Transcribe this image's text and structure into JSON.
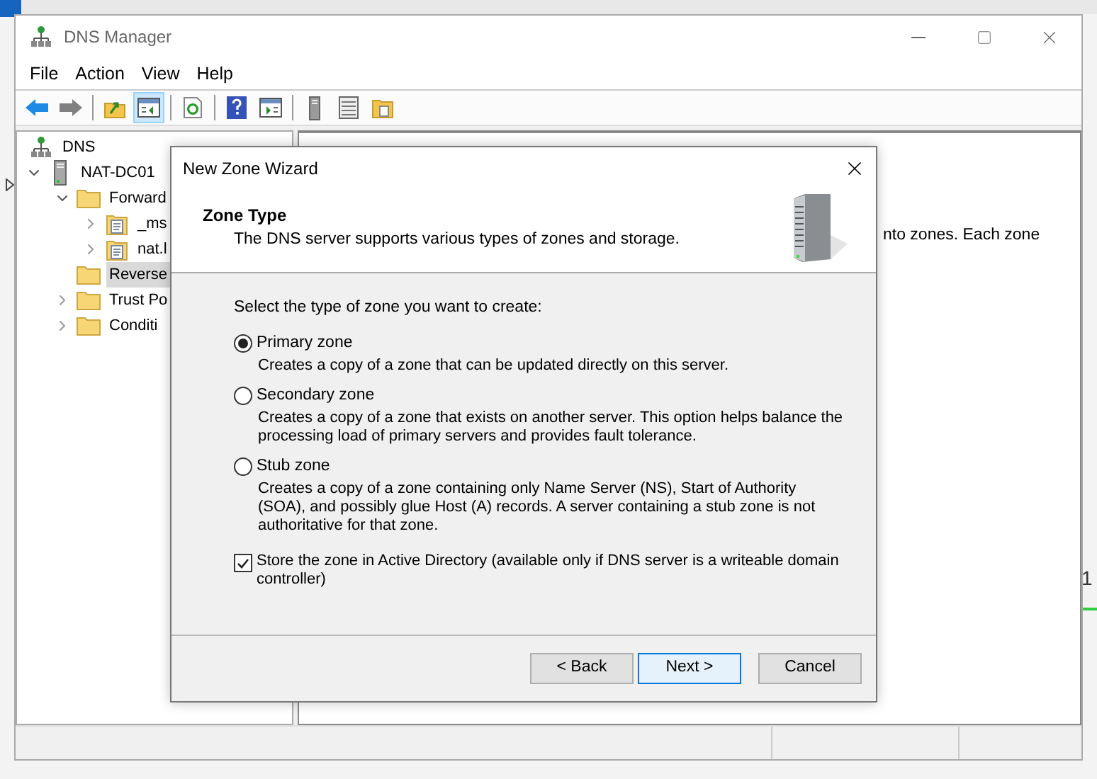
{
  "background": {
    "side_text": "1"
  },
  "window": {
    "title": "DNS Manager",
    "menu": [
      "File",
      "Action",
      "View",
      "Help"
    ],
    "toolbar": [
      {
        "kind": "back",
        "pressed": false
      },
      {
        "kind": "forward",
        "pressed": false
      },
      {
        "kind": "sep"
      },
      {
        "kind": "up",
        "pressed": false
      },
      {
        "kind": "tree",
        "pressed": true
      },
      {
        "kind": "sep"
      },
      {
        "kind": "refresh",
        "pressed": false
      },
      {
        "kind": "sep"
      },
      {
        "kind": "help",
        "pressed": false
      },
      {
        "kind": "pane",
        "pressed": false
      },
      {
        "kind": "sep"
      },
      {
        "kind": "server",
        "pressed": false
      },
      {
        "kind": "list",
        "pressed": false
      },
      {
        "kind": "folderdoc",
        "pressed": false
      }
    ],
    "tree": [
      {
        "label": "DNS",
        "kind": "dns",
        "selected": false,
        "children": [
          {
            "label": "NAT-DC01",
            "kind": "server",
            "expanded": true,
            "selected": false,
            "children": [
              {
                "label": "Forward",
                "kind": "folder",
                "expanded": true,
                "selected": false,
                "children": [
                  {
                    "label": "_ms",
                    "kind": "zone",
                    "expanded": false,
                    "selected": false
                  },
                  {
                    "label": "nat.l",
                    "kind": "zone",
                    "expanded": false,
                    "selected": false
                  }
                ]
              },
              {
                "label": "Reverse",
                "kind": "folder",
                "selected": true
              },
              {
                "label": "Trust Po",
                "kind": "folder",
                "expanded": false,
                "selected": false
              },
              {
                "label": "Conditi",
                "kind": "folder",
                "expanded": false,
                "selected": false
              }
            ]
          }
        ]
      }
    ],
    "right_pane_text": "nto zones. Each zone"
  },
  "dialog": {
    "title": "New Zone Wizard",
    "header": {
      "title": "Zone Type",
      "subtitle": "The DNS server supports various types of zones and storage."
    },
    "prompt": "Select the type of zone you want to create:",
    "options": [
      {
        "label": "Primary zone",
        "description": "Creates a copy of a zone that can be updated directly on this server.",
        "selected": true
      },
      {
        "label": "Secondary zone",
        "description": "Creates a copy of a zone that exists on another server. This option helps balance the processing load of primary servers and provides fault tolerance.",
        "selected": false
      },
      {
        "label": "Stub zone",
        "description": "Creates a copy of a zone containing only Name Server (NS), Start of Authority (SOA), and possibly glue Host (A) records. A server containing a stub zone is not authoritative for that zone.",
        "selected": false
      }
    ],
    "store": {
      "label": "Store the zone in Active Directory (available only if DNS server is a writeable domain controller)",
      "checked": true
    },
    "buttons": [
      {
        "label": "< Back",
        "default": false
      },
      {
        "label": "Next >",
        "default": true
      },
      {
        "label": "Cancel",
        "default": false
      }
    ]
  }
}
